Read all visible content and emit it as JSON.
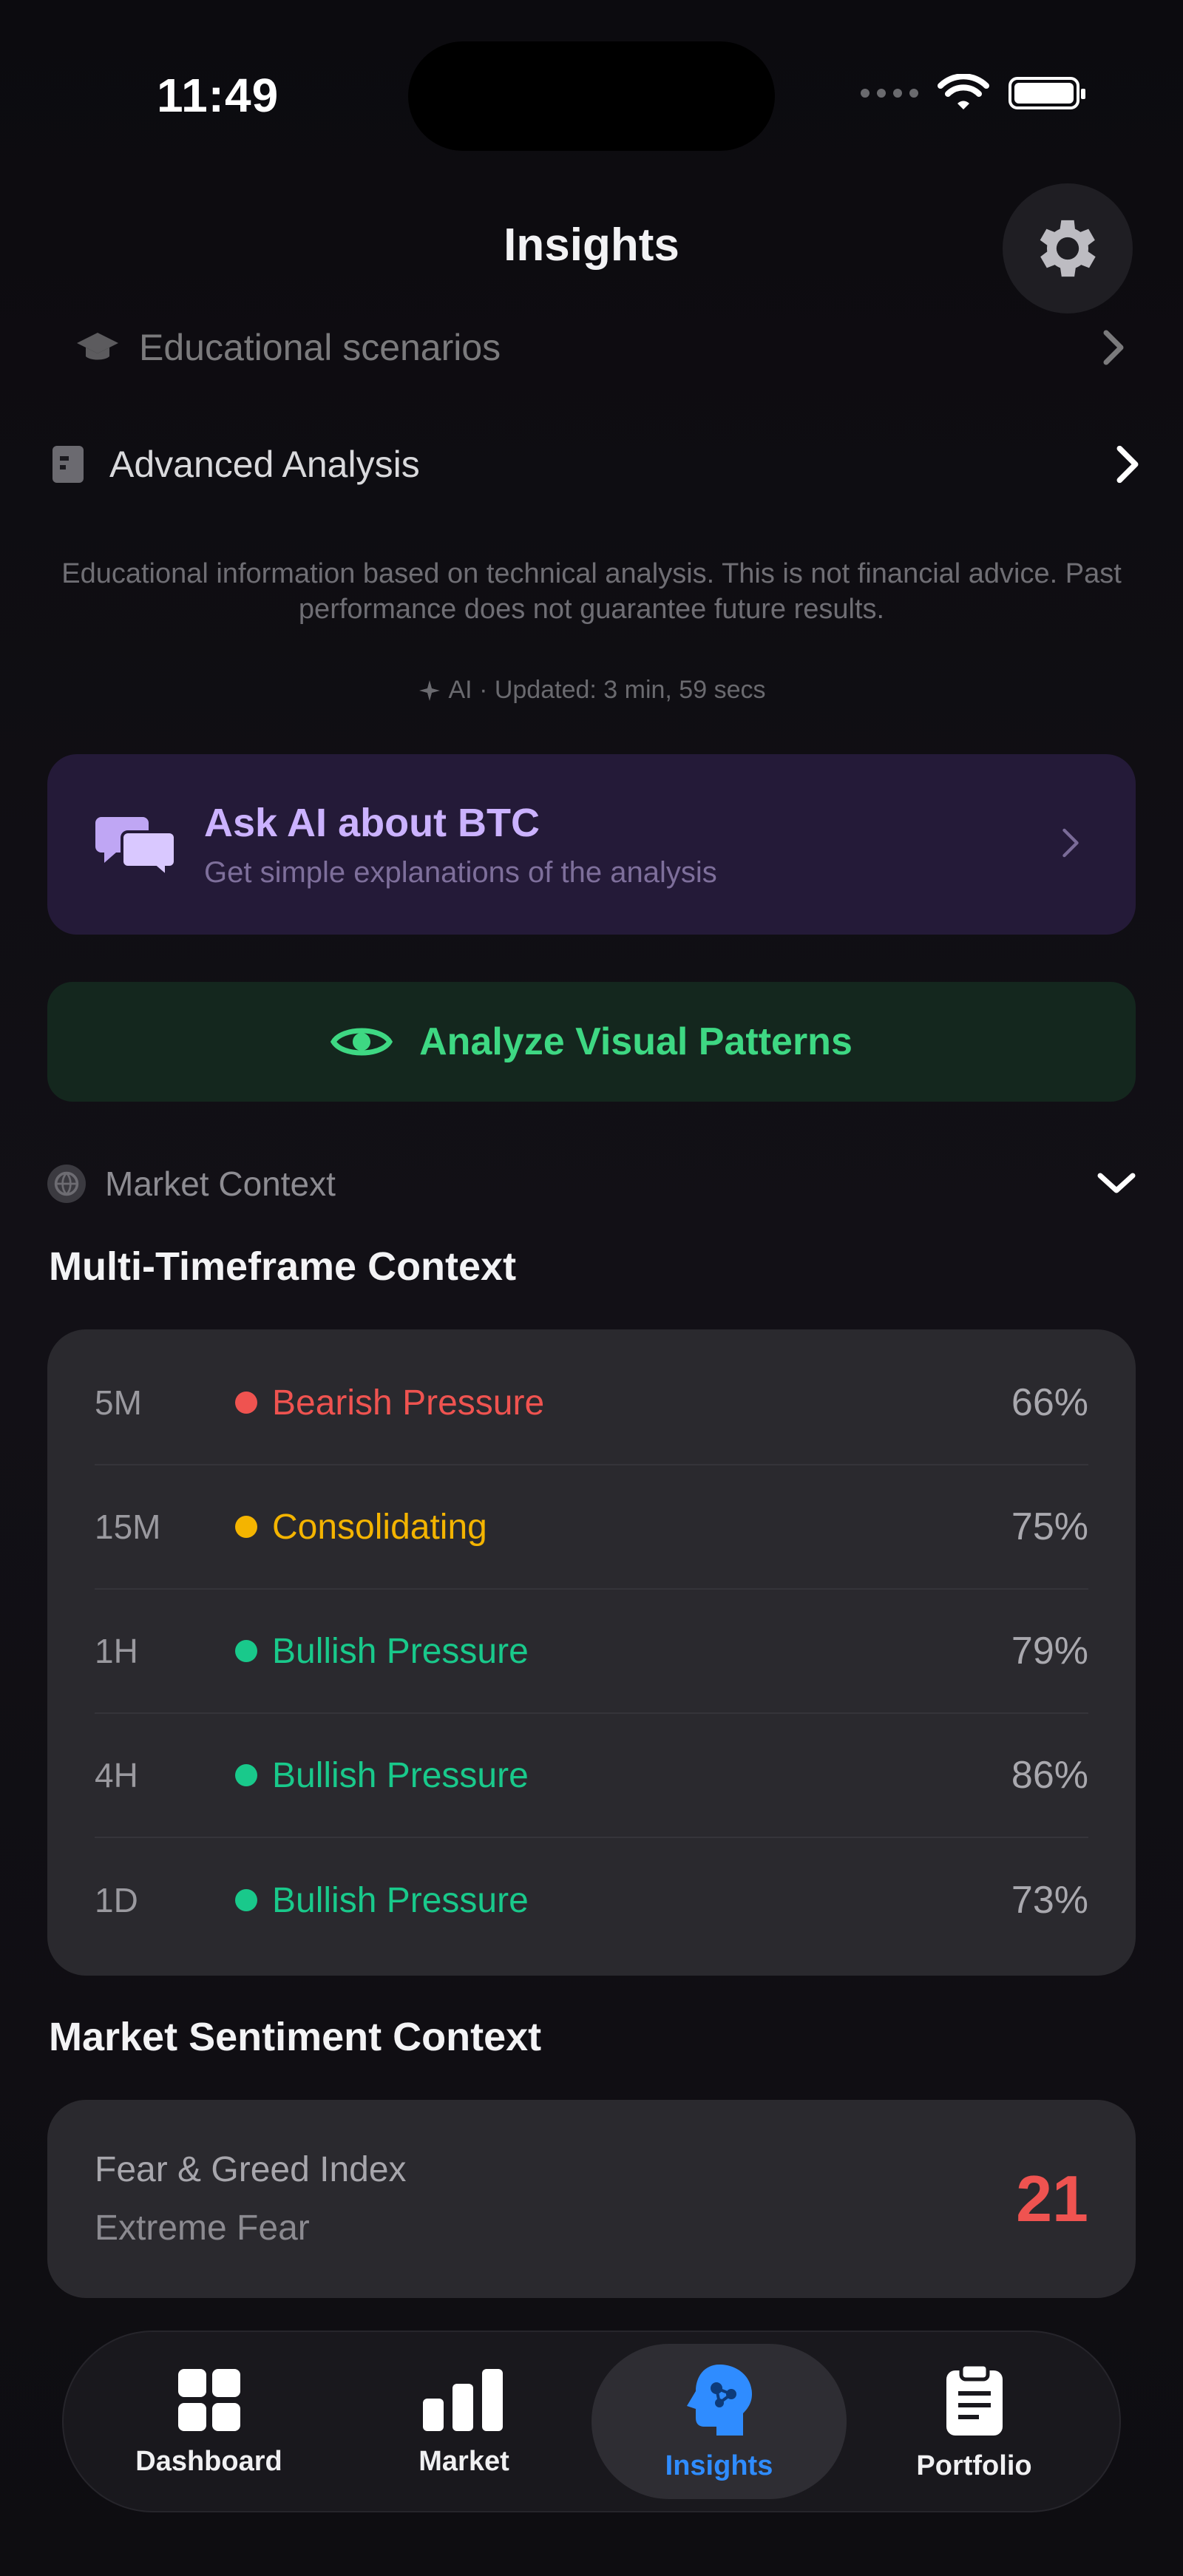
{
  "status_bar": {
    "time": "11:49"
  },
  "header": {
    "title": "Insights"
  },
  "rows": {
    "educational": "Educational scenarios",
    "advanced": "Advanced Analysis"
  },
  "disclaimer": "Educational information based on technical analysis. This is not financial advice. Past performance does not guarantee future results.",
  "ai_updated": "AI · Updated: 3 min, 59 secs",
  "ask_ai": {
    "title": "Ask AI about BTC",
    "subtitle": "Get simple explanations of the analysis"
  },
  "analyze_button": "Analyze Visual Patterns",
  "market_context": {
    "label": "Market Context",
    "multi_timeframe_title": "Multi-Timeframe Context",
    "timeframes": [
      {
        "tf": "5M",
        "status": "Bearish Pressure",
        "pct": "66%",
        "color": "#ef5350"
      },
      {
        "tf": "15M",
        "status": "Consolidating",
        "pct": "75%",
        "color": "#f4b400"
      },
      {
        "tf": "1H",
        "status": "Bullish Pressure",
        "pct": "79%",
        "color": "#19c98b"
      },
      {
        "tf": "4H",
        "status": "Bullish Pressure",
        "pct": "86%",
        "color": "#19c98b"
      },
      {
        "tf": "1D",
        "status": "Bullish Pressure",
        "pct": "73%",
        "color": "#19c98b"
      }
    ]
  },
  "sentiment": {
    "title": "Market Sentiment Context",
    "index_label": "Fear & Greed Index",
    "index_state": "Extreme Fear",
    "index_value": "21",
    "value_color": "#ef5350"
  },
  "tabs": [
    {
      "label": "Dashboard",
      "icon": "grid-icon",
      "active": false
    },
    {
      "label": "Market",
      "icon": "bar-chart-icon",
      "active": false
    },
    {
      "label": "Insights",
      "icon": "brain-icon",
      "active": true
    },
    {
      "label": "Portfolio",
      "icon": "clipboard-icon",
      "active": false
    }
  ],
  "colors": {
    "accent_purple": "#cbb2ff",
    "accent_green": "#3ed883",
    "active_tab": "#2f8cff"
  }
}
